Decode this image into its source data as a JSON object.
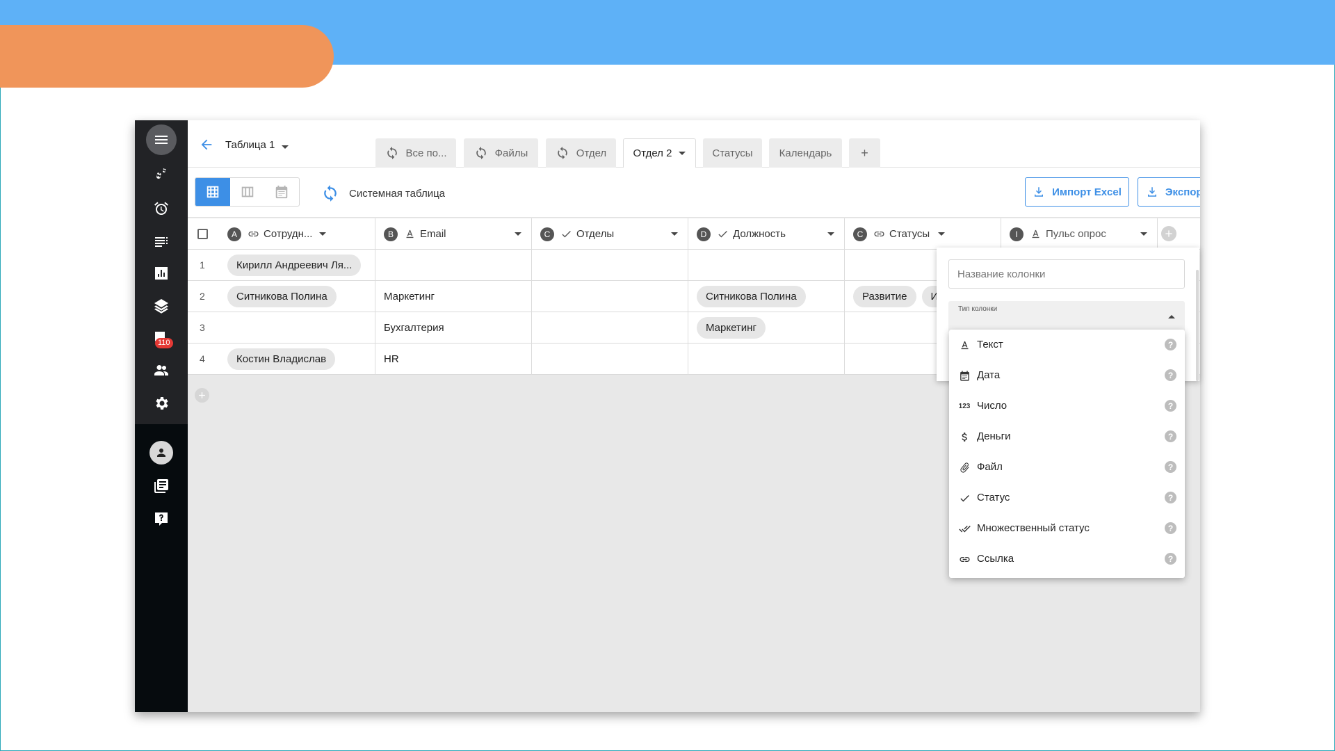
{
  "header": {
    "table_title": "Таблица 1"
  },
  "tabs": [
    {
      "label": "Все по...",
      "synced": true
    },
    {
      "label": "Файлы",
      "synced": true
    },
    {
      "label": "Отдел",
      "synced": true
    },
    {
      "label": "Отдел 2",
      "active": true
    },
    {
      "label": "Статусы"
    },
    {
      "label": "Календарь"
    },
    {
      "label": "+"
    }
  ],
  "rail": {
    "notification_count": "110"
  },
  "toolbar": {
    "system_table_label": "Системная таблица",
    "import_label": "Импорт Excel",
    "export_label": "Экспорт Excel"
  },
  "columns": [
    {
      "letter": "A",
      "type_icon": "link-icon",
      "label": "Сотрудн..."
    },
    {
      "letter": "B",
      "type_icon": "text-icon",
      "label": "Email"
    },
    {
      "letter": "C",
      "type_icon": "check-icon",
      "label": "Отделы"
    },
    {
      "letter": "D",
      "type_icon": "check-icon",
      "label": "Должность"
    },
    {
      "letter": "C",
      "type_icon": "link-icon",
      "label": "Статусы"
    },
    {
      "letter": "I",
      "type_icon": "text-icon",
      "label": "Пульс опрос"
    }
  ],
  "rows": [
    {
      "num": "1",
      "employee": "Кирилл Андреевич Ля...",
      "email": "",
      "departments": "",
      "position": "",
      "statuses": ""
    },
    {
      "num": "2",
      "employee": "Ситникова Полина",
      "email": "Маркетинг",
      "departments": "",
      "position": "Ситникова Полина",
      "statuses": "Развитие",
      "statuses_extra": "И"
    },
    {
      "num": "3",
      "employee": "",
      "email": "Бухгалтерия",
      "departments": "",
      "position": "Маркетинг",
      "statuses": ""
    },
    {
      "num": "4",
      "employee": "Костин Владислав",
      "email": "HR",
      "departments": "",
      "position": "",
      "statuses": ""
    }
  ],
  "popup": {
    "name_placeholder": "Название колонки",
    "type_label": "Тип колонки",
    "types": [
      {
        "icon": "text-type-icon",
        "label": "Текст"
      },
      {
        "icon": "calendar-icon",
        "label": "Дата"
      },
      {
        "icon": "number-icon",
        "glyph": "123",
        "label": "Число"
      },
      {
        "icon": "dollar-icon",
        "label": "Деньги"
      },
      {
        "icon": "paperclip-icon",
        "label": "Файл"
      },
      {
        "icon": "check-icon",
        "label": "Статус"
      },
      {
        "icon": "double-check-icon",
        "label": "Множественный статус"
      },
      {
        "icon": "link-icon",
        "label": "Ссылка"
      }
    ],
    "help_glyph": "?"
  },
  "colors": {
    "accent": "#3d8fe6",
    "top_band": "#5eb1f7",
    "orange": "#f0955a",
    "rail": "#060b0e",
    "badge": "#e53935"
  }
}
